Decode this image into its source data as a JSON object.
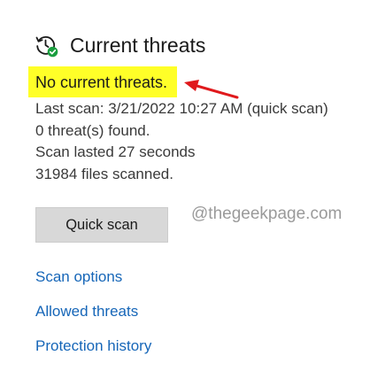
{
  "header": {
    "title": "Current threats",
    "icon": "clock-shield-check-icon"
  },
  "status": {
    "message": "No current threats.",
    "highlight_color": "#ffff28",
    "annotation_arrow_color": "#e0191c"
  },
  "scan_info": {
    "last_scan": "Last scan: 3/21/2022 10:27 AM (quick scan)",
    "threats_found": "0 threat(s) found.",
    "duration": "Scan lasted 27 seconds",
    "files_scanned": "31984 files scanned."
  },
  "actions": {
    "quick_scan_label": "Quick scan"
  },
  "watermark": "@thegeekpage.com",
  "links": {
    "scan_options": "Scan options",
    "allowed_threats": "Allowed threats",
    "protection_history": "Protection history"
  },
  "colors": {
    "link": "#1666b8",
    "button_bg": "#d8d8d8",
    "check_badge": "#1a9e3f"
  }
}
